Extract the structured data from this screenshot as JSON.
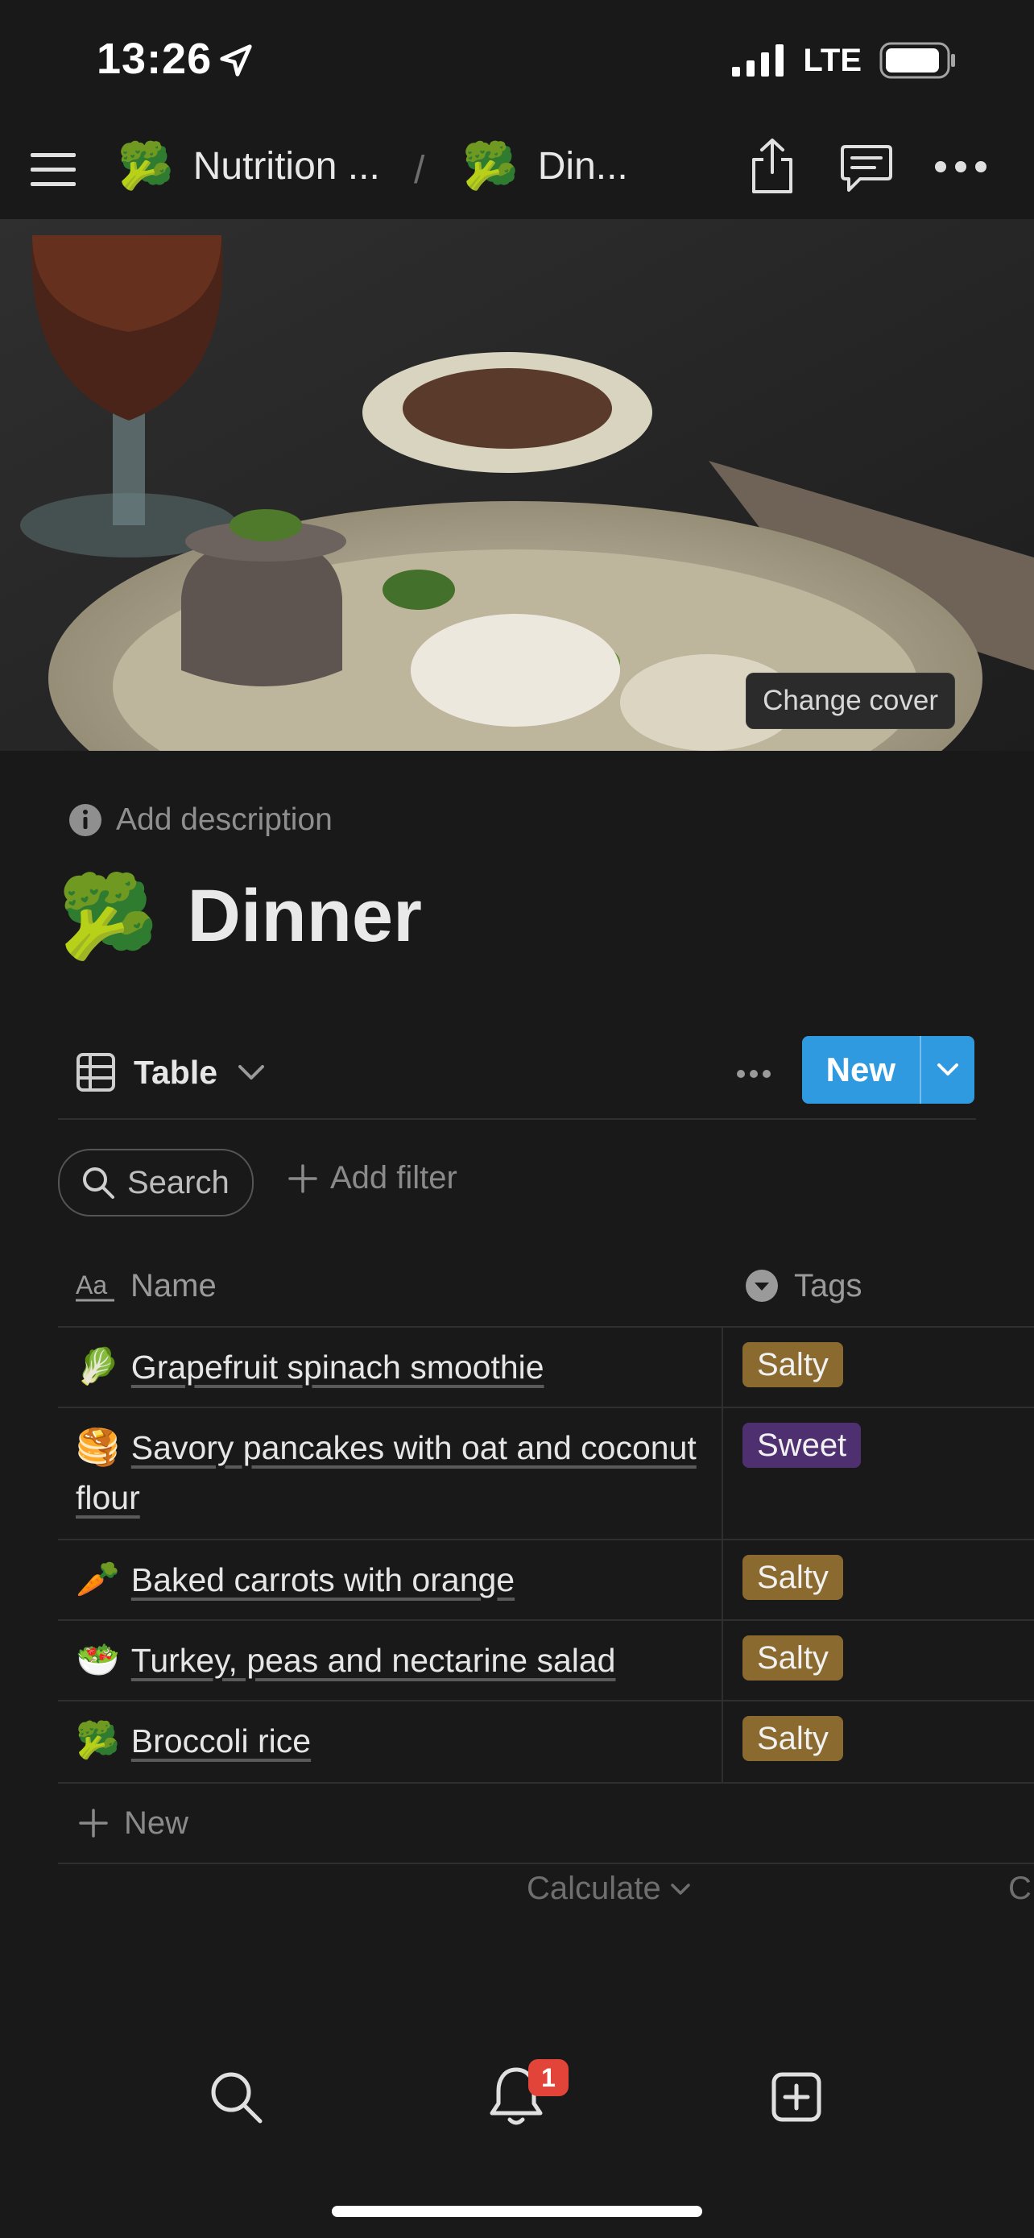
{
  "status_bar": {
    "time": "13:26",
    "network": "LTE"
  },
  "nav": {
    "breadcrumb_workspace": "Nutrition ...",
    "separator": "/",
    "breadcrumb_page": "Din...",
    "icons": [
      "menu-icon",
      "share-icon",
      "comment-icon",
      "more-icon"
    ]
  },
  "cover": {
    "change_label": "Change cover"
  },
  "page": {
    "description_placeholder": "Add description",
    "emoji": "🥦",
    "title": "Dinner"
  },
  "view": {
    "label": "Table",
    "new_label": "New"
  },
  "toolbar": {
    "search_label": "Search",
    "filter_label": "Add filter"
  },
  "table": {
    "headers": {
      "name": "Name",
      "tags": "Tags"
    },
    "rows": [
      {
        "emoji": "🥬",
        "name": "Grapefruit spinach smoothie",
        "tag": "Salty"
      },
      {
        "emoji": "🥞",
        "name": "Savory pancakes with oat and coconut flour",
        "tag": "Sweet"
      },
      {
        "emoji": "🥕",
        "name": "Baked carrots with orange",
        "tag": "Salty"
      },
      {
        "emoji": "🥗",
        "name": "Turkey, peas and nectarine salad",
        "tag": "Salty"
      },
      {
        "emoji": "🥦",
        "name": "Broccoli rice",
        "tag": "Salty"
      }
    ],
    "new_row_label": "New",
    "calculate_label": "Calculate",
    "calculate_clip": "C"
  },
  "bottom_bar": {
    "notification_count": "1"
  },
  "colors": {
    "background": "#191919",
    "accent_blue": "#2f9ae0",
    "tag_salty": "#8a6a2e",
    "tag_sweet": "#4e2f70",
    "badge_red": "#e3443a"
  }
}
